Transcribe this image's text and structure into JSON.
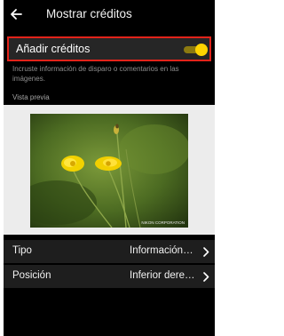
{
  "header": {
    "title": "Mostrar créditos",
    "back_icon": "arrow-left-icon"
  },
  "toggle": {
    "label": "Añadir créditos",
    "state": "on",
    "accent_color": "#ffd400",
    "highlight_color": "#e2231a"
  },
  "description": "Incruste información de disparo o comentarios en las imágenes.",
  "preview": {
    "label": "Vista previa",
    "watermark": "NIKON CORPORATION"
  },
  "settings": {
    "rows": [
      {
        "label": "Tipo",
        "value": "Información de disparo"
      },
      {
        "label": "Posición",
        "value": "Inferior derecha"
      }
    ],
    "chevron_icon": "chevron-right-icon"
  }
}
